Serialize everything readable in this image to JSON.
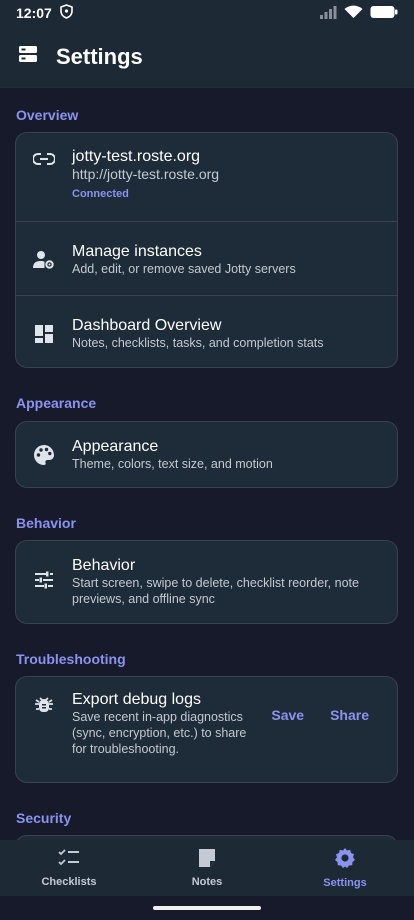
{
  "status_bar": {
    "time": "12:07"
  },
  "app_bar": {
    "title": "Settings",
    "icon": "settings-list-icon"
  },
  "sections": {
    "overview": {
      "header": "Overview",
      "instance": {
        "name": "jotty-test.roste.org",
        "url": "http://jotty-test.roste.org",
        "status": "Connected",
        "icon": "link-icon"
      },
      "manage": {
        "title": "Manage instances",
        "subtitle": "Add, edit, or remove saved Jotty servers",
        "icon": "manage-accounts-icon"
      },
      "dashboard": {
        "title": "Dashboard Overview",
        "subtitle": "Notes, checklists, tasks, and completion stats",
        "icon": "dashboard-icon"
      }
    },
    "appearance": {
      "header": "Appearance",
      "item": {
        "title": "Appearance",
        "subtitle": "Theme, colors, text size, and motion",
        "icon": "palette-icon"
      }
    },
    "behavior": {
      "header": "Behavior",
      "item": {
        "title": "Behavior",
        "subtitle": "Start screen, swipe to delete, checklist reorder, note previews, and offline sync",
        "icon": "tune-icon"
      }
    },
    "troubleshooting": {
      "header": "Troubleshooting",
      "item": {
        "title": "Export debug logs",
        "subtitle": "Save recent in-app diagnostics (sync, encryption, etc.) to share for troubleshooting.",
        "save_label": "Save",
        "share_label": "Share",
        "icon": "bug-icon"
      }
    },
    "security": {
      "header": "Security"
    }
  },
  "bottom_nav": {
    "items": [
      {
        "label": "Checklists",
        "icon": "checklist-icon"
      },
      {
        "label": "Notes",
        "icon": "note-icon"
      },
      {
        "label": "Settings",
        "icon": "gear-icon"
      }
    ],
    "active": "Settings"
  },
  "colors": {
    "background": "#171a2b",
    "surface": "#1e2b38",
    "bar": "#1d2a36",
    "accent": "#8b93ee",
    "border": "#39434f"
  }
}
